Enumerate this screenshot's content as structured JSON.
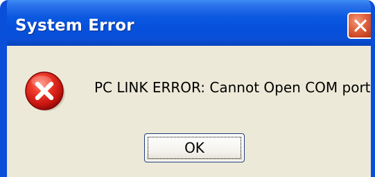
{
  "window": {
    "title": "System Error"
  },
  "titlebar": {
    "close_icon": "close-icon"
  },
  "dialog": {
    "icon": "error-icon",
    "message": "PC LINK ERROR: Cannot Open COM port",
    "ok_label": "OK"
  },
  "colors": {
    "titlebar_blue": "#0550dc",
    "dialog_background": "#ece9d8",
    "close_button_red": "#e0643f",
    "error_icon_red": "#d81a14"
  }
}
